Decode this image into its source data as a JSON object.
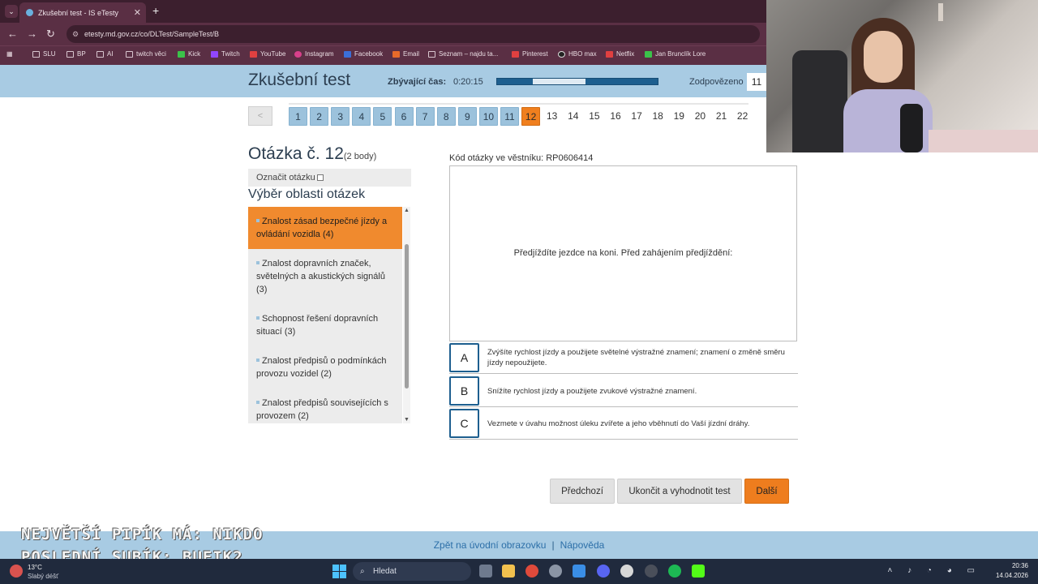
{
  "browser": {
    "tab_title": "Zkušební test - IS eTesty",
    "tab_close": "✕",
    "new_tab": "+",
    "tab_menu": "⌄",
    "url": "etesty.md.gov.cz/co/DLTest/SampleTest/B",
    "bookmarks": [
      "SLU",
      "BP",
      "AI",
      "twitch věci",
      "Kick",
      "Twitch",
      "YouTube",
      "Instagram",
      "Facebook",
      "Email",
      "Seznam – najdu ta...",
      "Pinterest",
      "HBO max",
      "Netflix",
      "Jan Brunclík Lore"
    ]
  },
  "header": {
    "title": "Zkušební test",
    "time_label": "Zbývající čas:",
    "time_value": "0:20:15",
    "time_remaining_fraction": 0.67,
    "answered_label": "Zodpovězeno",
    "answered_count": "11"
  },
  "question_nav": {
    "prev_label": "<",
    "numbers": [
      "1",
      "2",
      "3",
      "4",
      "5",
      "6",
      "7",
      "8",
      "9",
      "10",
      "11",
      "12",
      "13",
      "14",
      "15",
      "16",
      "17",
      "18",
      "19",
      "20",
      "21",
      "22"
    ],
    "answered_up_to": 11,
    "current": 12
  },
  "question": {
    "heading": "Otázka č. 12",
    "points": "(2 body)",
    "mark_label": "Označit otázku",
    "code": "Kód otázky ve věstníku: RP0606414",
    "text": "Předjíždíte jezdce na koni. Před zahájením předjíždění:",
    "answers": [
      {
        "letter": "A",
        "text": "Zvýšíte rychlost jízdy a použijete světelné výstražné znamení; znamení o změně směru jízdy nepoužijete."
      },
      {
        "letter": "B",
        "text": "Snížíte rychlost jízdy a použijete zvukové výstražné znamení."
      },
      {
        "letter": "C",
        "text": "Vezmete v úvahu možnost úleku zvířete a jeho vběhnutí do Vaší jízdní dráhy."
      }
    ]
  },
  "areas": {
    "heading": "Výběr oblasti otázek",
    "items": [
      "Znalost zásad bezpečné jízdy a ovládání vozidla (4)",
      "Znalost dopravních značek, světelných a akustických signálů (3)",
      "Schopnost řešení dopravních situací (3)",
      "Znalost předpisů o podmínkách provozu vozidel (2)",
      "Znalost předpisů souvisejících s provozem (2)"
    ]
  },
  "buttons": {
    "prev": "Předchozí",
    "finish": "Ukončit a vyhodnotit test",
    "next": "Další"
  },
  "footer": {
    "home_link": "Zpět na úvodní obrazovku",
    "separator": "|",
    "help_link": "Nápověda"
  },
  "overlay": {
    "line1": "NEJVĚTŠÍ PIPÍK MÁ: NIKDO",
    "line2": "POSLEDNÍ SUBÍK: BUFIK2"
  },
  "taskbar": {
    "temperature": "13°C",
    "weather": "Slabý déšť",
    "search": "Hledat",
    "time": "20:36",
    "date": "14.04.2026"
  }
}
